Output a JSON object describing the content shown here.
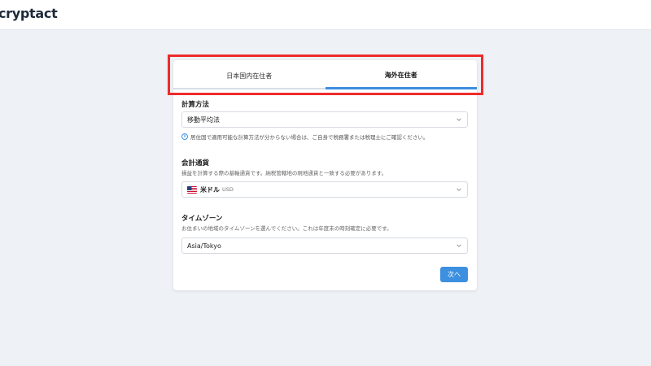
{
  "brand": {
    "logo_text": "cryptact"
  },
  "tabs": [
    {
      "label": "日本国内在住者",
      "active": false
    },
    {
      "label": "海外在住者",
      "active": true
    }
  ],
  "calc_method": {
    "title": "計算方法",
    "value": "移動平均法",
    "note": "居住国で適用可能な計算方法が分からない場合は、ご自身で税務署または税理士にご確認ください。"
  },
  "base_currency": {
    "title": "会計通貨",
    "description": "損益を計算する際の基軸通貨です。納税管轄地の現地通貨と一致する必要があります。",
    "value_name": "米ドル",
    "value_code": "USD",
    "flag": "us-flag-icon"
  },
  "timezone": {
    "title": "タイムゾーン",
    "description": "お住まいの地域のタイムゾーンを選んでください。これは年度末の時刻確定に必要です。",
    "value": "Asia/Tokyo"
  },
  "actions": {
    "next_label": "次へ"
  },
  "colors": {
    "accent": "#3d8fe0",
    "highlight_border": "#ee2b2b",
    "background": "#eef1f6"
  }
}
